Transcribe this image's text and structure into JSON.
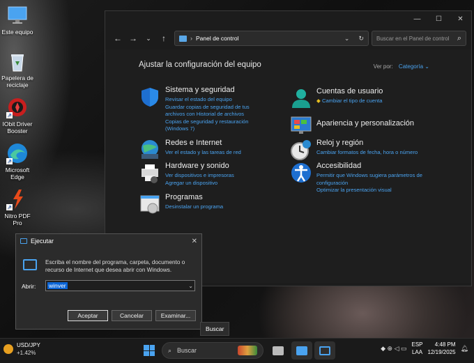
{
  "desktop": {
    "icons": [
      {
        "label": "Este equipo"
      },
      {
        "label": "Papelera de reciclaje"
      },
      {
        "label": "IObit Driver Booster"
      },
      {
        "label": "Microsoft Edge"
      },
      {
        "label": "Nitro PDF Pro"
      }
    ]
  },
  "control_panel": {
    "address": {
      "path": "Panel de control"
    },
    "search_placeholder": "Buscar en el Panel de control",
    "heading": "Ajustar la configuración del equipo",
    "view_by": {
      "label": "Ver por:",
      "value": "Categoría"
    },
    "categories": [
      {
        "title": "Sistema y seguridad",
        "links": [
          "Revisar el estado del equipo",
          "Guardar copias de seguridad de tus archivos con Historial de archivos",
          "Copias de seguridad y restauración (Windows 7)"
        ]
      },
      {
        "title": "Redes e Internet",
        "links": [
          "Ver el estado y las tareas de red"
        ]
      },
      {
        "title": "Hardware y sonido",
        "links": [
          "Ver dispositivos e impresoras",
          "Agregar un dispositivo"
        ]
      },
      {
        "title": "Programas",
        "links": [
          "Desinstalar un programa"
        ]
      },
      {
        "title": "Cuentas de usuario",
        "links": [
          "Cambiar el tipo de cuenta"
        ]
      },
      {
        "title": "Apariencia y personalización",
        "links": []
      },
      {
        "title": "Reloj y región",
        "links": [
          "Cambiar formatos de fecha, hora o número"
        ]
      },
      {
        "title": "Accesibilidad",
        "links": [
          "Permitir que Windows sugiera parámetros de configuración",
          "Optimizar la presentación visual"
        ]
      }
    ]
  },
  "run_dialog": {
    "title": "Ejecutar",
    "message": "Escriba el nombre del programa, carpeta, documento o recurso de Internet que desea abrir con Windows.",
    "open_label": "Abrir:",
    "input_value": "winver",
    "buttons": {
      "ok": "Aceptar",
      "cancel": "Cancelar",
      "browse": "Examinar..."
    }
  },
  "tooltip": "Buscar",
  "taskbar": {
    "widget": {
      "title": "USD/JPY",
      "change": "+1.42%"
    },
    "search_label": "Buscar",
    "lang": {
      "line1": "ESP",
      "line2": "LAA"
    },
    "clock": {
      "time": "4:48 PM",
      "date": "12/19/2025"
    }
  },
  "colors": {
    "accent": "#4aa3f0",
    "link": "#4aa3f0",
    "selection": "#0a64d6"
  }
}
